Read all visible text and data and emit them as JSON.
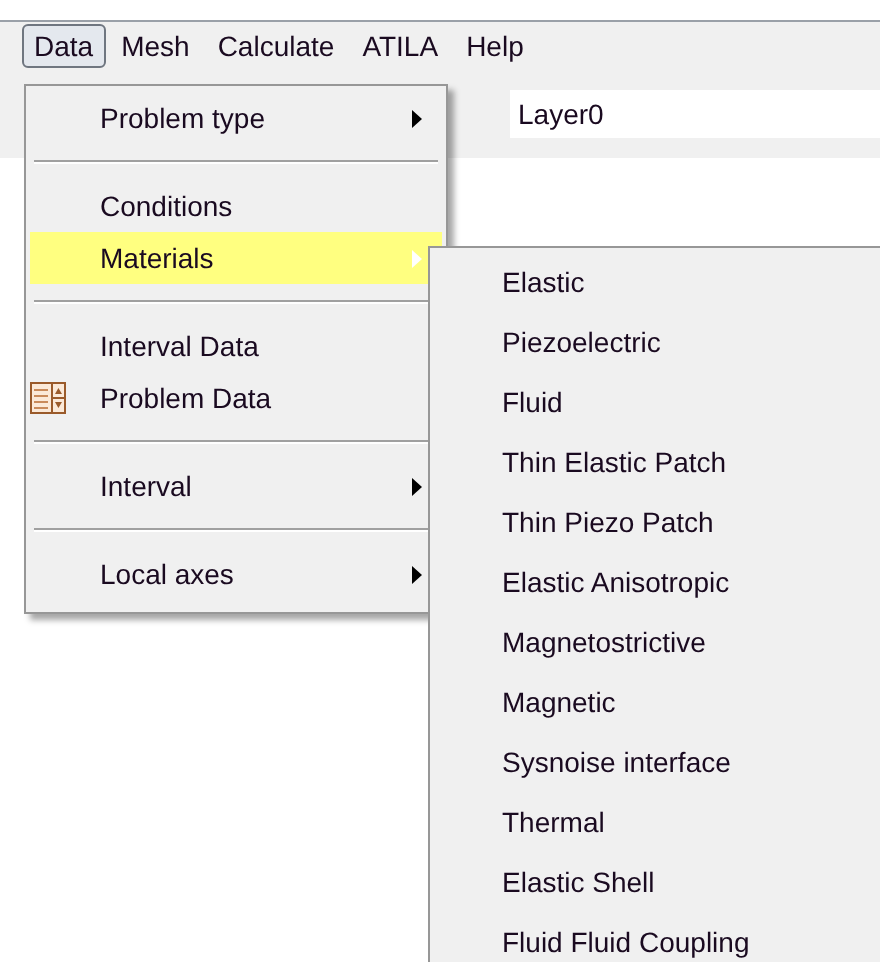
{
  "menubar": [
    {
      "label": "Data",
      "selected": true
    },
    {
      "label": "Mesh",
      "selected": false
    },
    {
      "label": "Calculate",
      "selected": false
    },
    {
      "label": "ATILA",
      "selected": false
    },
    {
      "label": "Help",
      "selected": false
    }
  ],
  "layer_field": {
    "value": "Layer0"
  },
  "menu": [
    {
      "kind": "item",
      "label": "Problem type",
      "submenu": true,
      "selected": false
    },
    {
      "kind": "separator"
    },
    {
      "kind": "item",
      "label": "Conditions",
      "submenu": false,
      "selected": false
    },
    {
      "kind": "item",
      "label": "Materials",
      "submenu": true,
      "selected": true
    },
    {
      "kind": "separator"
    },
    {
      "kind": "item",
      "label": "Interval Data",
      "submenu": false,
      "selected": false
    },
    {
      "kind": "icon_item",
      "label": "Problem Data",
      "submenu": false,
      "selected": false
    },
    {
      "kind": "separator"
    },
    {
      "kind": "item",
      "label": "Interval",
      "submenu": true,
      "selected": false
    },
    {
      "kind": "separator"
    },
    {
      "kind": "item",
      "label": "Local axes",
      "submenu": true,
      "selected": false
    }
  ],
  "submenu": [
    "Elastic",
    "Piezoelectric",
    "Fluid",
    "Thin Elastic Patch",
    "Thin Piezo Patch",
    "Elastic Anisotropic",
    "Magnetostrictive",
    "Magnetic",
    "Sysnoise interface",
    "Thermal",
    "Elastic Shell",
    "Fluid Fluid Coupling"
  ]
}
